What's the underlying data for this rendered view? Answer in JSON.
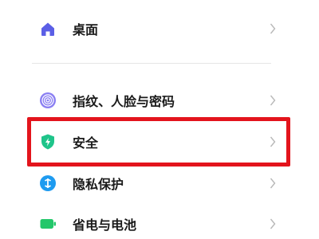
{
  "settings": {
    "items": [
      {
        "label": "桌面",
        "icon": "home-icon"
      },
      {
        "label": "指纹、人脸与密码",
        "icon": "fingerprint-icon"
      },
      {
        "label": "安全",
        "icon": "shield-icon"
      },
      {
        "label": "隐私保护",
        "icon": "privacy-icon"
      },
      {
        "label": "省电与电池",
        "icon": "battery-icon"
      }
    ]
  },
  "colors": {
    "home": "#5b5fe6",
    "fingerprint": "#7a6cf0",
    "security": "#1fc48a",
    "privacy": "#1e9bf0",
    "battery": "#23c76a",
    "highlight": "#e3141c"
  }
}
